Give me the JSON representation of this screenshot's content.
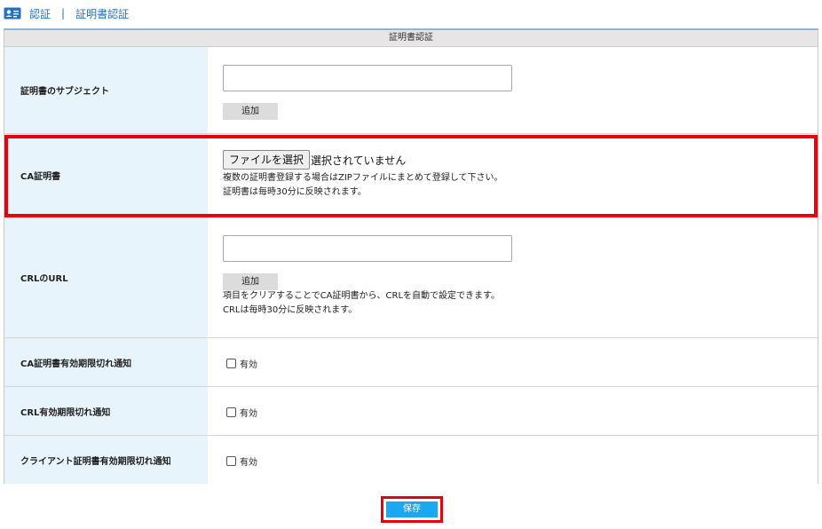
{
  "breadcrumb": {
    "icon": "id-card-icon",
    "items": [
      "認証",
      "証明書認証"
    ],
    "separator": "|"
  },
  "panel": {
    "title": "証明書認証"
  },
  "rows": {
    "subject": {
      "label": "証明書のサブジェクト",
      "input_value": "",
      "add_label": "追加"
    },
    "ca_cert": {
      "label": "CA証明書",
      "file_button": "ファイルを選択",
      "file_status": "選択されていません",
      "notes": [
        "複数の証明書登録する場合はZIPファイルにまとめて登録して下さい。",
        "証明書は毎時30分に反映されます。"
      ]
    },
    "crl_url": {
      "label": "CRLのURL",
      "input_value": "",
      "add_label": "追加",
      "notes": [
        "項目をクリアすることでCA証明書から、CRLを自動で設定できます。",
        "CRLは毎時30分に反映されます。"
      ]
    },
    "ca_expiry": {
      "label": "CA証明書有効期限切れ通知",
      "checkbox_label": "有効",
      "checked": false
    },
    "crl_expiry": {
      "label": "CRL有効期限切れ通知",
      "checkbox_label": "有効",
      "checked": false
    },
    "client_expiry": {
      "label": "クライアント証明書有効期限切れ通知",
      "checkbox_label": "有効",
      "checked": false
    }
  },
  "actions": {
    "save_label": "保存"
  },
  "colors": {
    "link": "#1f74c8",
    "label_bg": "#e8f4fc",
    "highlight": "#e8000b",
    "save_bg": "#1aa8f0"
  }
}
